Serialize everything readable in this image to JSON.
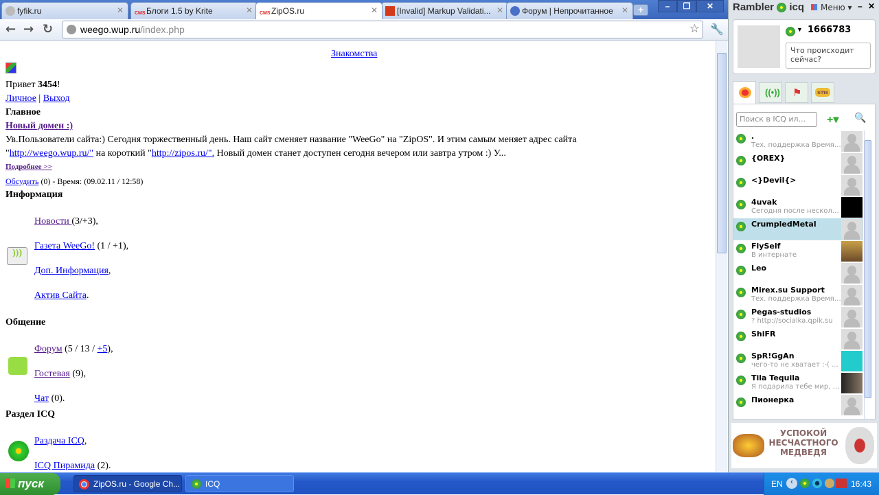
{
  "browser": {
    "tabs": [
      {
        "title": "fyfik.ru"
      },
      {
        "title": "Блоги 1.5 by Krite"
      },
      {
        "title": "ZipOS.ru",
        "active": true
      },
      {
        "title": "[Invalid] Markup Validati..."
      },
      {
        "title": "Форум | Непрочитанное"
      }
    ],
    "new_tab": "+",
    "url_host": "weego.wup.ru",
    "url_path": "/index.php"
  },
  "page": {
    "top_link": "Знакомства",
    "greeting_prefix": "Привет ",
    "username": "3454",
    "greeting_suffix": "!",
    "link_personal": "Личное",
    "separator": " | ",
    "link_logout": "Выход",
    "heading_main": "Главное",
    "news_title": "Новый домен :)",
    "news_text1": "Ув.Пользователи сайта:) Сегодня торжественный день. Наш сайт сменяет название \"WeeGo\" на \"ZipOS\". И этим самым меняет адрес сайта",
    "news_text2_a": "\"",
    "news_link1": "http://weego.wup.ru/\"",
    "news_text2_b": " на короткий \"",
    "news_link2": "http://zipos.ru/\".",
    "news_text2_c": " Новый домен станет доступен сегодня вечером или завтра утром :) У...",
    "more_link": "Подробнее >>",
    "discuss_link": "Обсудить",
    "discuss_meta": " (0) - Время: (09.02.11 / 12:58)",
    "sections": {
      "info": {
        "heading": "Информация",
        "items": [
          {
            "link": "Новости ",
            "suffix": "(3/+3),"
          },
          {
            "link": "Газета WeeGo!",
            "suffix": " (1 / +1),"
          },
          {
            "link": "Доп. Информация",
            "suffix": ","
          },
          {
            "link": "Актив Сайта",
            "suffix": "."
          }
        ]
      },
      "chat": {
        "heading": "Общение",
        "forum_link": "Форум",
        "forum_mid": " (5 / 13 / ",
        "forum_new": "+5",
        "forum_end": "),",
        "guest_link": "Гостевая",
        "guest_suffix": " (9),",
        "chat_link": "Чат",
        "chat_suffix": " (0)."
      },
      "icq": {
        "heading": "Раздел ICQ",
        "items": [
          {
            "link": "Раздача ICQ",
            "suffix": ","
          },
          {
            "link": "ICQ Пирамида",
            "suffix": " (2)."
          }
        ]
      }
    }
  },
  "icq": {
    "brand": "Rambler",
    "brand2": "icq",
    "menu": "Меню",
    "uin": "1666783",
    "status_placeholder": "Что происходит сейчас?",
    "search_placeholder": "Поиск в ICQ ил...",
    "contacts": [
      {
        "name": ".",
        "status": "Тех. поддержка Время ..."
      },
      {
        "name": "{OREX}",
        "status": ""
      },
      {
        "name": "<}Devil{>",
        "status": ""
      },
      {
        "name": "4uvak",
        "status": "Сегодня после несколь..."
      },
      {
        "name": "CrumpledMetal",
        "status": ""
      },
      {
        "name": "FlySelf",
        "status": "В интернате"
      },
      {
        "name": "Leo",
        "status": ""
      },
      {
        "name": "Mirex.su Support",
        "status": "Тех. поддержка Время ..."
      },
      {
        "name": "Pegas-studios",
        "status": "? http://socialka.qpik.su"
      },
      {
        "name": "ShiFR",
        "status": ""
      },
      {
        "name": "SpR!GgAn",
        "status": "чего-то не хватает :-( ..."
      },
      {
        "name": "Tila Tequila",
        "status": "Я подарила тебе мир, н..."
      },
      {
        "name": "Пионерка",
        "status": ""
      }
    ],
    "ad_text": "УСПОКОЙ НЕСЧАСТНОГО МЕДВЕДЯ",
    "ad_logo": "Ягодка"
  },
  "taskbar": {
    "start": "пуск",
    "tasks": [
      {
        "label": "ZipOS.ru - Google Ch..."
      },
      {
        "label": "ICQ"
      }
    ],
    "lang": "EN",
    "clock": "16:43"
  }
}
